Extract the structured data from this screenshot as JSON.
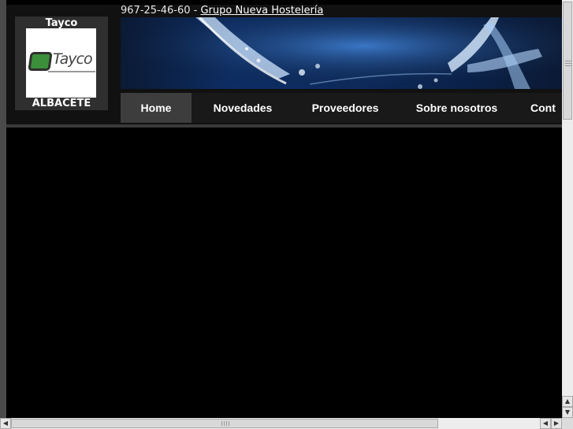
{
  "logo": {
    "top_label": "Tayco",
    "brand_word": "Tayco",
    "bottom_label": "ALBACETE"
  },
  "contact": {
    "phone": "967-25-46-60",
    "separator": " - ",
    "group_link": "Grupo Nueva Hostelería"
  },
  "nav": {
    "items": [
      {
        "label": "Home",
        "active": true
      },
      {
        "label": "Novedades",
        "active": false
      },
      {
        "label": "Proveedores",
        "active": false
      },
      {
        "label": "Sobre nosotros",
        "active": false
      },
      {
        "label": "Cont",
        "active": false
      }
    ]
  },
  "colors": {
    "page_background": "#000000",
    "header_background": "#111111",
    "nav_background": "#191919",
    "nav_active": "#3d3d3d",
    "brand_green": "#3c8f3a"
  },
  "icons": {
    "scroll_up": "arrow-up-icon",
    "scroll_down": "arrow-down-icon",
    "scroll_left": "arrow-left-icon",
    "scroll_right": "arrow-right-icon"
  }
}
